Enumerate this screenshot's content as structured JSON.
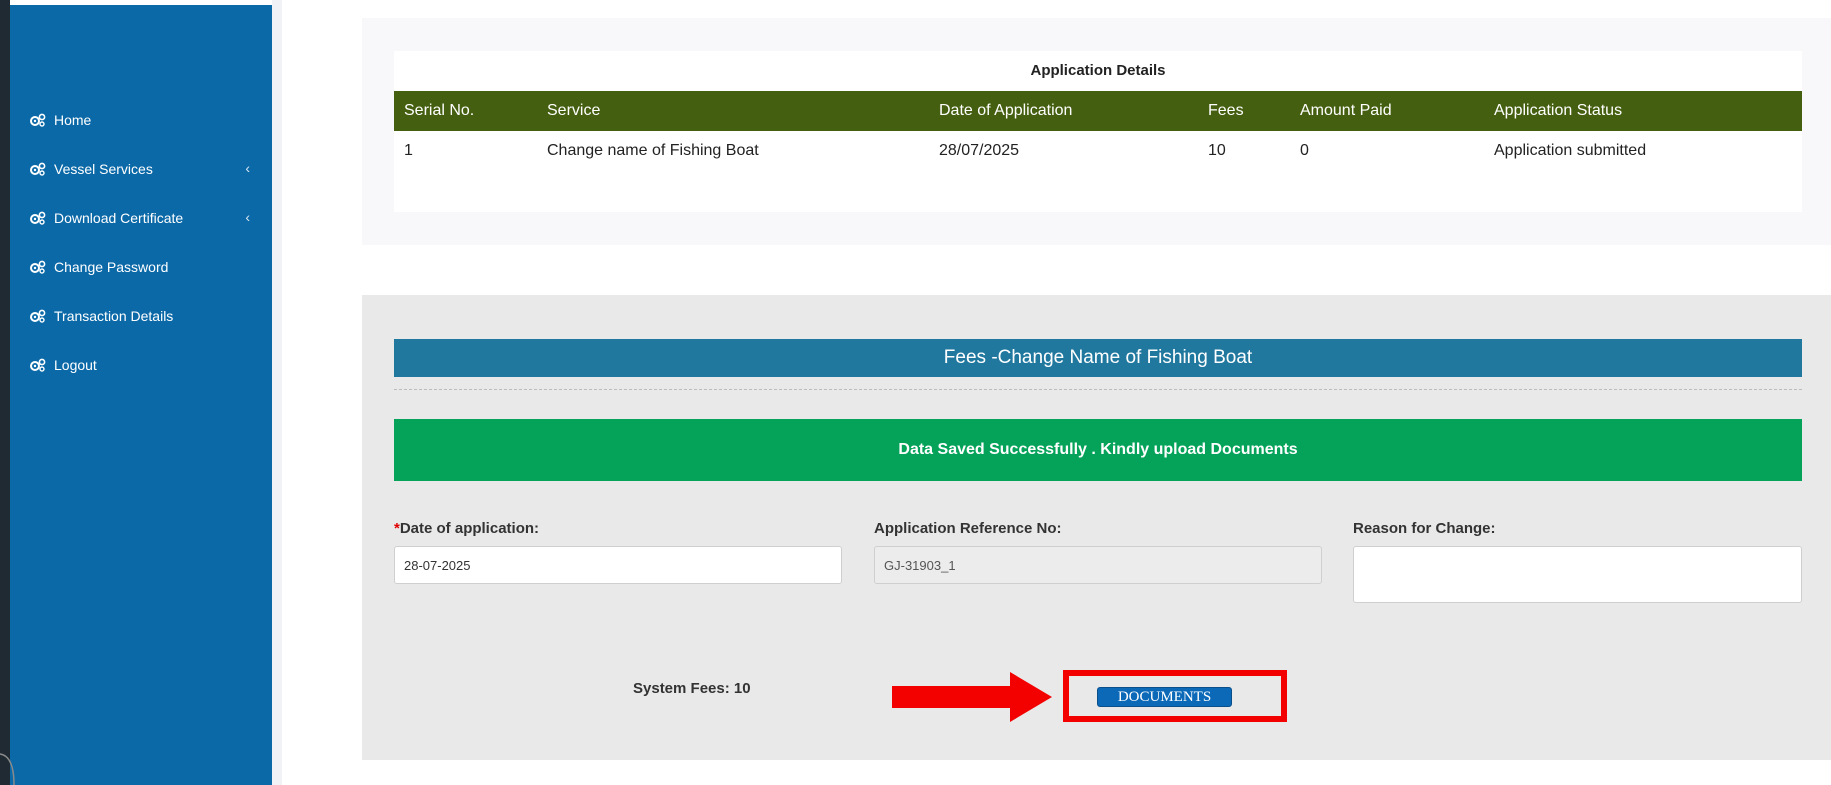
{
  "sidebar": {
    "items": [
      {
        "label": "Home",
        "icon": "gear-icon",
        "has_submenu": false
      },
      {
        "label": "Vessel Services",
        "icon": "gear-icon",
        "has_submenu": true
      },
      {
        "label": "Download Certificate",
        "icon": "gear-icon",
        "has_submenu": true
      },
      {
        "label": "Change Password",
        "icon": "gear-icon",
        "has_submenu": false
      },
      {
        "label": "Transaction Details",
        "icon": "gear-icon",
        "has_submenu": false
      },
      {
        "label": "Logout",
        "icon": "gear-icon",
        "has_submenu": false
      }
    ],
    "chevron": "‹"
  },
  "application_details": {
    "title": "Application Details",
    "columns": [
      "Serial No.",
      "Service",
      "Date of Application",
      "Fees",
      "Amount Paid",
      "Application Status"
    ],
    "rows": [
      [
        "1",
        "Change name of Fishing Boat",
        "28/07/2025",
        "10",
        "0",
        "Application submitted"
      ]
    ]
  },
  "fees_form": {
    "header": "Fees -Change Name of Fishing Boat",
    "success_message": "Data Saved Successfully . Kindly upload Documents",
    "date_label_required": "*",
    "date_label": "Date of application:",
    "date_value": "28-07-2025",
    "ref_label": "Application Reference No:",
    "ref_value": "GJ-31903_1",
    "reason_label": "Reason for Change:",
    "reason_value": "",
    "system_fees": "System Fees: 10",
    "documents_button": "DOCUMENTS"
  },
  "colors": {
    "sidebar": "#0b69a8",
    "table_header": "#455f10",
    "fees_header": "#20789f",
    "success": "#05a35a",
    "highlight": "#f30000"
  }
}
